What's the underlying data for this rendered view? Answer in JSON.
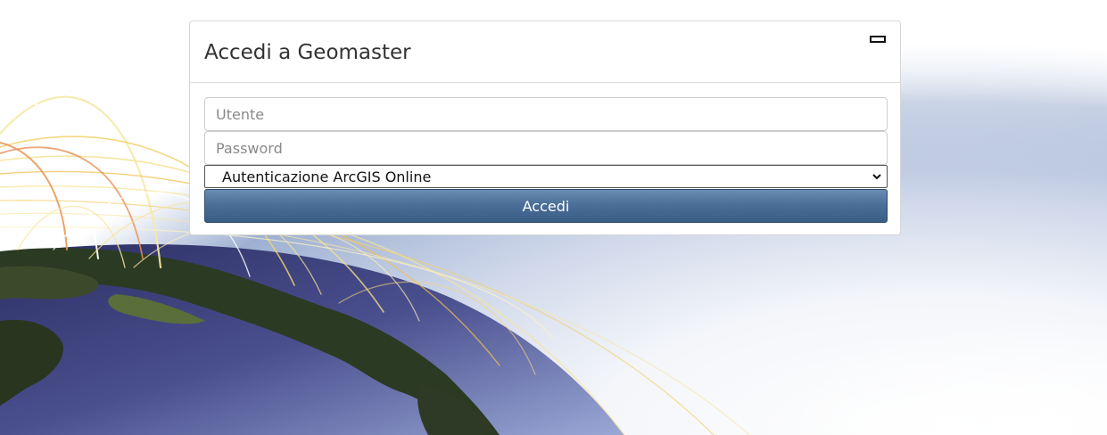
{
  "login": {
    "title": "Accedi a Geomaster",
    "username_placeholder": "Utente",
    "password_placeholder": "Password",
    "auth_method_selected": "Autenticazione ArcGIS Online",
    "submit_label": "Accedi"
  },
  "colors": {
    "button_top": "#6a8cb2",
    "button_bottom": "#3a5d86",
    "panel_border": "#d6d6d6"
  },
  "icons": {
    "minimize": "minimize-icon",
    "select_arrow": "chevron-down-icon"
  }
}
